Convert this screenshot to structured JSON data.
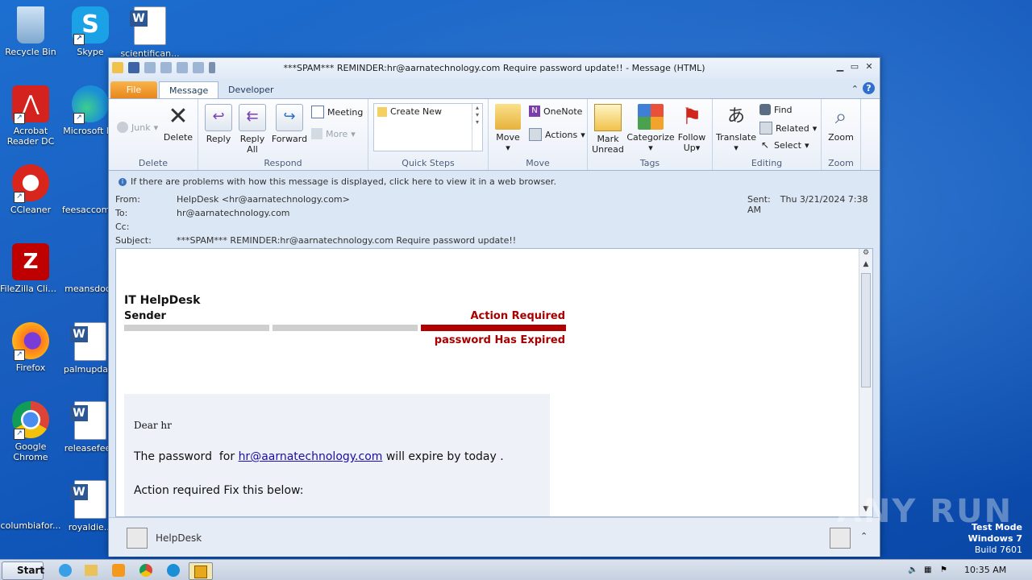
{
  "desktop": {
    "icons": [
      {
        "label": "Recycle Bin"
      },
      {
        "label": "Skype"
      },
      {
        "label": "scientifican..."
      },
      {
        "label": "Acrobat Reader DC"
      },
      {
        "label": "Microsoft Ed"
      },
      {
        "label": "CCleaner"
      },
      {
        "label": "feesaccomm"
      },
      {
        "label": "FileZilla Client"
      },
      {
        "label": "meansdocu"
      },
      {
        "label": "Firefox"
      },
      {
        "label": "palmupdate"
      },
      {
        "label": "Google Chrome"
      },
      {
        "label": "releasefeed"
      },
      {
        "label": "columbiafor..."
      },
      {
        "label": "royaldie..."
      }
    ],
    "watermark": {
      "line1": "Test Mode",
      "line2": "Windows 7",
      "line3": "Build 7601"
    },
    "brand": "ANY RUN"
  },
  "window": {
    "title": "***SPAM***  REMINDER:hr@aarnatechnology.com Require password update!! - Message (HTML)",
    "tabs": {
      "file": "File",
      "message": "Message",
      "developer": "Developer"
    },
    "ribbon": {
      "delete_group": {
        "label": "Delete",
        "junk": "Junk",
        "delete": "Delete"
      },
      "respond_group": {
        "label": "Respond",
        "reply": "Reply",
        "reply_all_1": "Reply",
        "reply_all_2": "All",
        "forward": "Forward",
        "meeting": "Meeting",
        "more": "More"
      },
      "quicksteps_group": {
        "label": "Quick Steps",
        "create_new": "Create New"
      },
      "move_group": {
        "label": "Move",
        "move": "Move",
        "onenote": "OneNote",
        "actions": "Actions"
      },
      "tags_group": {
        "label": "Tags",
        "mark_unread_1": "Mark",
        "mark_unread_2": "Unread",
        "categorize": "Categorize",
        "follow_up_1": "Follow",
        "follow_up_2": "Up"
      },
      "editing_group": {
        "label": "Editing",
        "translate": "Translate",
        "find": "Find",
        "related": "Related",
        "select": "Select"
      },
      "zoom_group": {
        "label": "Zoom",
        "zoom": "Zoom"
      }
    },
    "infobar": "If there are problems with how this message is displayed, click here to view it in a web browser.",
    "header": {
      "from_label": "From:",
      "from": "HelpDesk <hr@aarnatechnology.com>",
      "to_label": "To:",
      "to": "hr@aarnatechnology.com",
      "cc_label": "Cc:",
      "cc": "",
      "subject_label": "Subject:",
      "subject": "***SPAM***  REMINDER:hr@aarnatechnology.com Require password update!!",
      "sent_label": "Sent:",
      "sent": "Thu 3/21/2024 7:38 AM"
    },
    "body": {
      "brand": "IT HelpDesk",
      "sender": "Sender",
      "action_required": "Action Required",
      "expired": "password Has Expired",
      "greeting": "Dear hr",
      "line1_pre": "The password  for ",
      "line1_link": "hr@aarnatechnology.com",
      "line1_post": " will expire by today .",
      "line2": "Action required Fix this below:"
    },
    "people_pane": {
      "name": "HelpDesk"
    }
  },
  "taskbar": {
    "start": "Start",
    "time": "10:35 AM"
  }
}
